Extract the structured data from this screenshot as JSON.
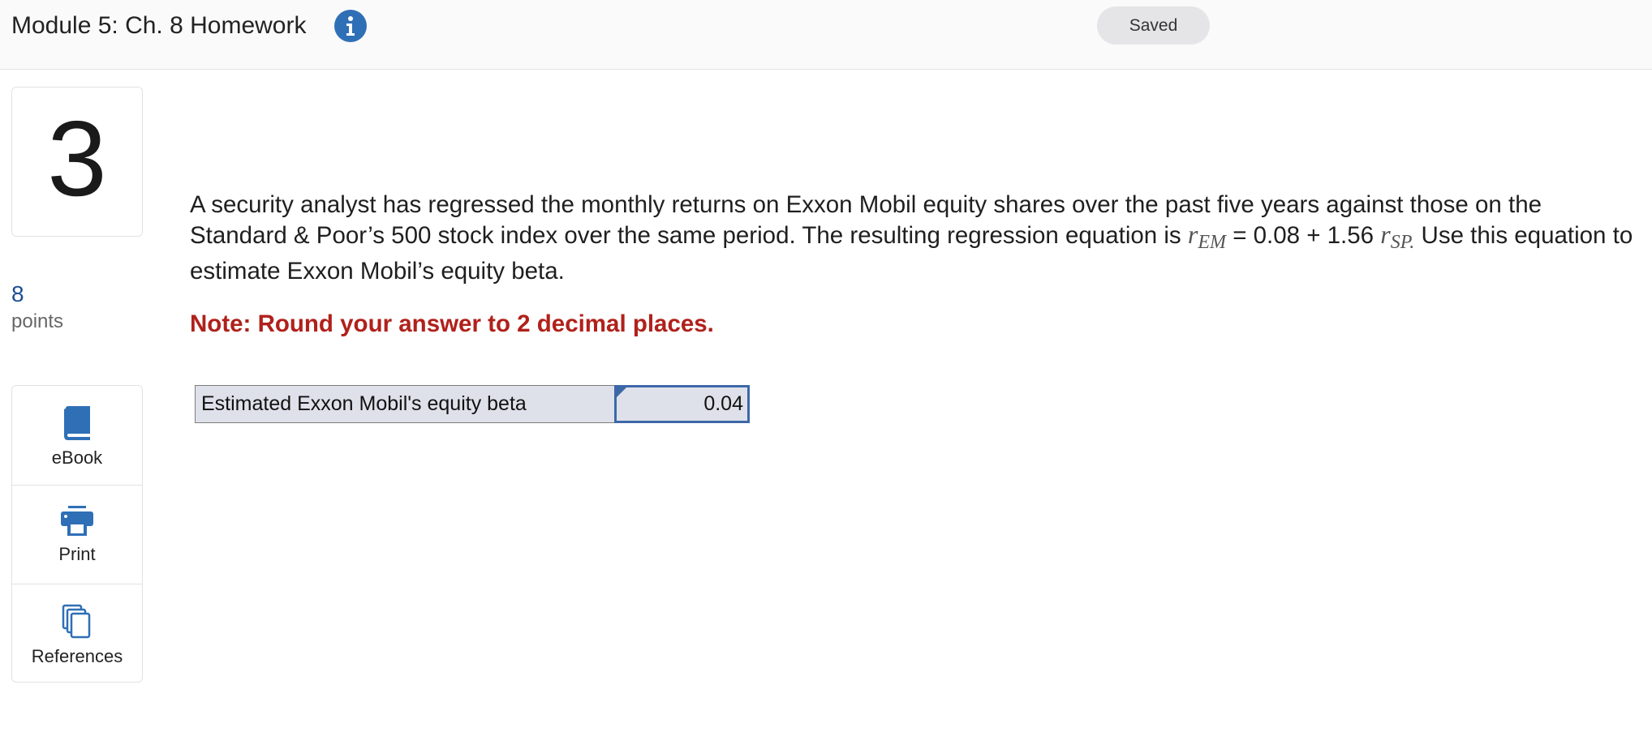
{
  "header": {
    "title": "Module 5: Ch. 8 Homework",
    "info_icon": "info-icon",
    "status": "Saved"
  },
  "question": {
    "number": "3",
    "points_value": "8",
    "points_label": "points",
    "text_part1": "A security analyst has regressed the monthly returns on Exxon Mobil equity shares over the past five years against those on the Standard & Poor’s 500 stock index over the same period. The resulting regression equation is ",
    "eq_var1": "r",
    "eq_sub1": "EM",
    "eq_middle": " = 0.08 + 1.56 ",
    "eq_var2": "r",
    "eq_sub2": "SP.",
    "text_part2": " Use this equation to estimate Exxon Mobil’s equity beta.",
    "note": "Note: Round your answer to 2 decimal places."
  },
  "tools": [
    {
      "label": "eBook",
      "icon": "book-icon"
    },
    {
      "label": "Print",
      "icon": "printer-icon"
    },
    {
      "label": "References",
      "icon": "documents-icon"
    }
  ],
  "answer": {
    "label": "Estimated Exxon Mobil's equity beta",
    "value": "0.04"
  },
  "colors": {
    "accent": "#2f6fb6",
    "note": "#b0211b",
    "points": "#1d4f91"
  }
}
